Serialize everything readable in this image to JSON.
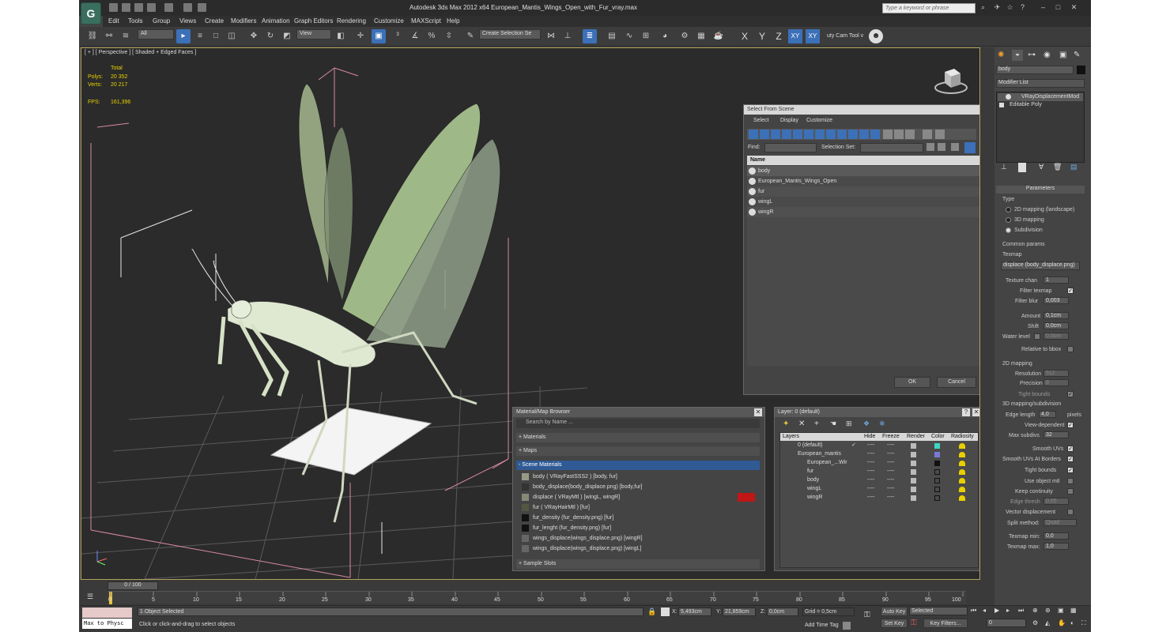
{
  "window": {
    "title": "Autodesk 3ds Max  2012 x64      European_Mantis_Wings_Open_with_Fur_vray.max",
    "search_placeholder": "Type a keyword or phrase"
  },
  "menu": [
    "Edit",
    "Tools",
    "Group",
    "Views",
    "Create",
    "Modifiers",
    "Animation",
    "Graph Editors",
    "Rendering",
    "Customize",
    "MAXScript",
    "Help"
  ],
  "toolbar": {
    "filter": "All",
    "refcoord": "View",
    "named_selection": "Create Selection Se",
    "axes": [
      "X",
      "Y",
      "Z",
      "XY",
      "XY"
    ],
    "cam_tool": "uty Cam Tool v"
  },
  "viewport": {
    "label": "[ + ] [ Perspective ] [ Shaded + Edged Faces ]",
    "stats": {
      "header": "Total",
      "polys_label": "Polys:",
      "polys": "20 352",
      "verts_label": "Verts:",
      "verts": "20 217",
      "fps_label": "FPS:",
      "fps": "161,396"
    }
  },
  "select_from_scene": {
    "title": "Select From Scene",
    "menu": [
      "Select",
      "Display",
      "Customize"
    ],
    "find_label": "Find:",
    "selection_set_label": "Selection Set:",
    "column": "Name",
    "items": [
      "body",
      "European_Mantis_Wings_Open",
      "fur",
      "wingL",
      "wingR"
    ],
    "ok": "OK",
    "cancel": "Cancel"
  },
  "material_browser": {
    "title": "Material/Map Browser",
    "search_placeholder": "Search by Name ...",
    "groups": [
      "+ Materials",
      "+ Maps",
      "- Scene Materials",
      "+ Sample Slots"
    ],
    "scene_materials": [
      "body  ( VRayFastSSS2 )  [body, fur]",
      "body_displace(body_displace.png) [body,fur]",
      "displace  ( VRayMtl )  [wingL, wingR]",
      "fur  ( VRayHairMtl )  [fur]",
      "fur_density (fur_density.png)  [fur]",
      "fur_lenght (fur_density.png)  [fur]",
      "wings_displace(wings_displace.png) [wingR]",
      "wings_displace(wings_displace.png) [wingL]"
    ]
  },
  "layer_panel": {
    "title": "Layer: 0 (default)",
    "columns": [
      "Layers",
      "Hide",
      "Freeze",
      "Render",
      "Color",
      "Radiosity"
    ],
    "rows": [
      "0 (default)",
      "European_mantis",
      "European_...Wir",
      "fur",
      "body",
      "wingL",
      "wingR"
    ],
    "row_dashes": "----"
  },
  "command_panel": {
    "object_name": "body",
    "modifier_list": "Modifier List",
    "stack": [
      "VRayDisplacementMod",
      "Editable Poly"
    ],
    "rollout_parameters": "Parameters",
    "type_label": "Type",
    "type_options": [
      "2D mapping (landscape)",
      "3D mapping",
      "Subdivision"
    ],
    "common_params": "Common params",
    "texmap_label": "Texmap",
    "texmap": "displace (body_displace.png)",
    "texture_chan_label": "Texture chan",
    "texture_chan": "1",
    "filter_texmap": "Filter texmap",
    "filter_blur_label": "Filter blur",
    "filter_blur": "0,003",
    "amount_label": "Amount",
    "amount": "0,1cm",
    "shift_label": "Shift",
    "shift": "0,0cm",
    "water_level_label": "Water level",
    "water_level": "0,0cm",
    "relative_bbox": "Relative to bbox",
    "mapping2d": "2D mapping",
    "resolution_label": "Resolution",
    "resolution": "512",
    "precision_label": "Precision",
    "precision": "8",
    "tight_bounds": "Tight bounds",
    "mapping3d": "3D mapping/subdivision",
    "edge_length_label": "Edge length",
    "edge_length": "4,0",
    "pixels": "pixels",
    "view_dependent": "View-dependent",
    "max_subdivs_label": "Max subdivs",
    "max_subdivs": "32",
    "smooth_uvs": "Smooth UVs",
    "smooth_uvs_borders": "Smooth UVs At Borders",
    "tight_bounds2": "Tight bounds",
    "use_object_mtl": "Use object mtl",
    "keep_continuity": "Keep continuity",
    "edge_thresh_label": "Edge thresh",
    "edge_thresh": "0,05",
    "vector_displacement": "Vector displacement",
    "split_method_label": "Split method:",
    "split_method": "Quad",
    "texmap_min_label": "Texmap min:",
    "texmap_min": "0,0",
    "texmap_max_label": "Texmap max:",
    "texmap_max": "1,0"
  },
  "timeline": {
    "slider": "0 / 100",
    "ticks": [
      "0",
      "5",
      "10",
      "15",
      "20",
      "25",
      "30",
      "35",
      "40",
      "45",
      "50",
      "55",
      "60",
      "65",
      "70",
      "75",
      "80",
      "85",
      "90",
      "95",
      "100"
    ]
  },
  "status": {
    "listener": "Max to Physc",
    "selected": "1 Object Selected",
    "prompt": "Click or click-and-drag to select objects",
    "x_label": "X:",
    "x": "5,493cm",
    "y_label": "Y:",
    "y": "21,859cm",
    "z_label": "Z:",
    "z": "0,0cm",
    "grid": "Grid = 0,5cm",
    "add_time_tag": "Add Time Tag",
    "auto_key": "Auto Key",
    "set_key": "Set Key",
    "selected_dropdown": "Selected",
    "key_filters": "Key Filters...",
    "frame": "0"
  }
}
